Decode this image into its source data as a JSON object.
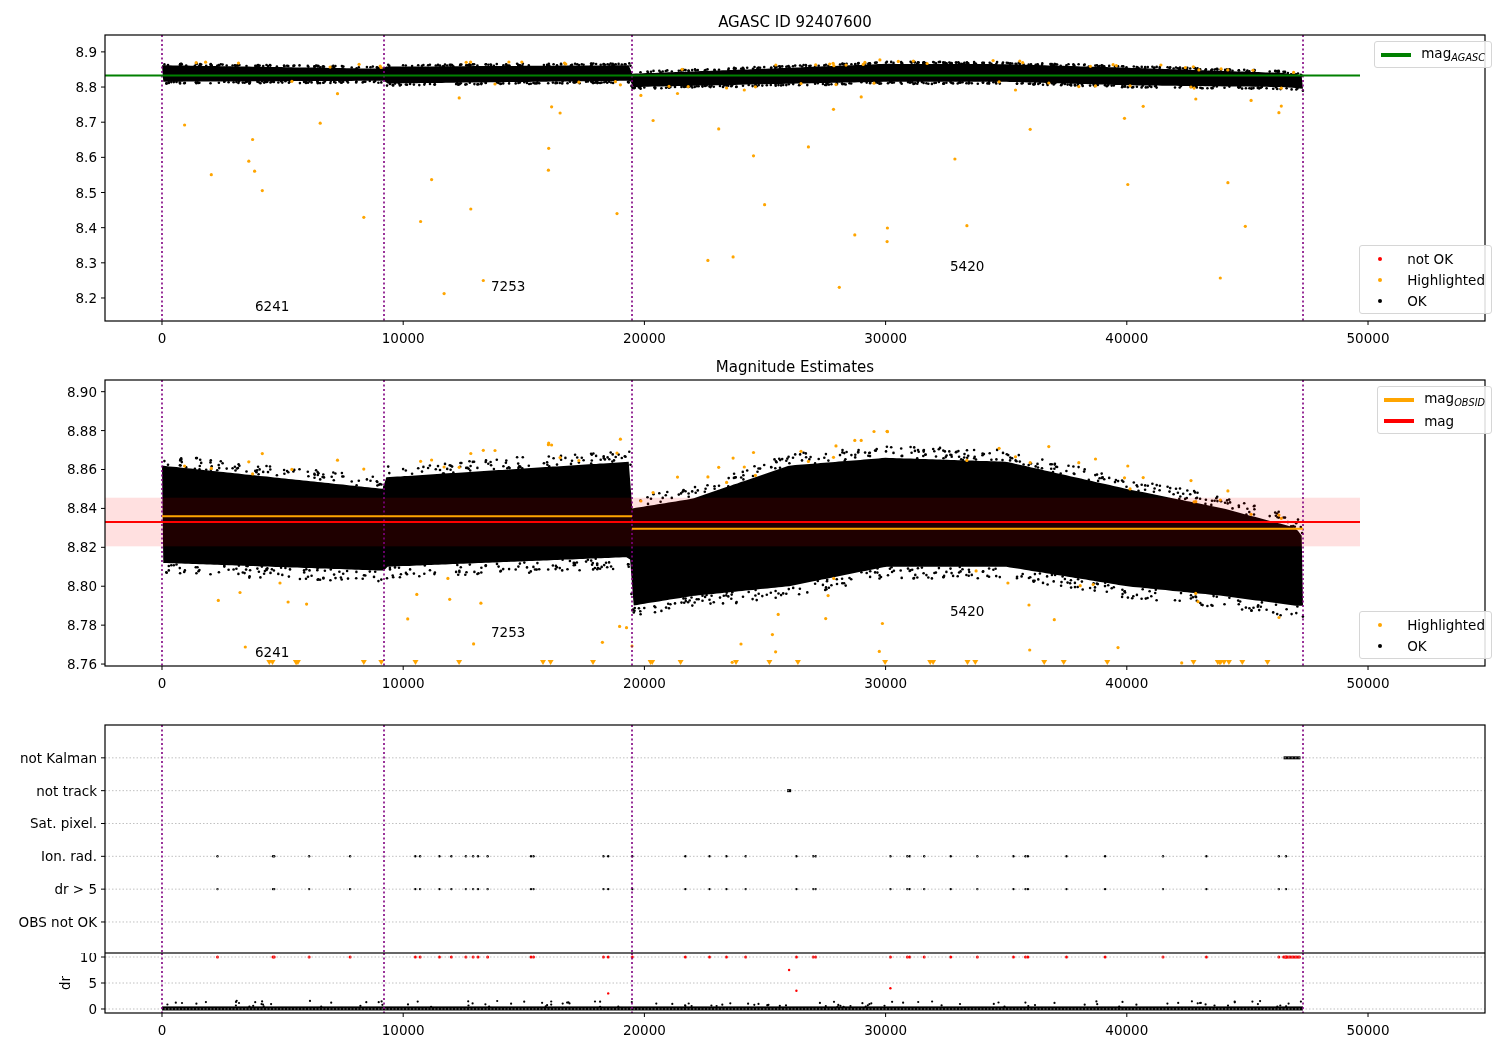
{
  "figure": {
    "panels": [
      {
        "kind": "agasc",
        "chart_data": {
          "type": "line",
          "title": "AGASC ID 92407600",
          "xlim": [
            -2363,
            54850
          ],
          "ylim": [
            8.1345,
            8.948
          ],
          "xticks": [
            0,
            10000,
            20000,
            30000,
            40000,
            50000
          ],
          "yticks": [
            8.2,
            8.3,
            8.4,
            8.5,
            8.6,
            8.7,
            8.8,
            8.9
          ],
          "series": [
            {
              "name": "mag$_{AGASC}$",
              "color": "#008000",
              "x": [
                -2363,
                49668
              ],
              "values": [
                8.833,
                8.833
              ]
            }
          ],
          "ref_lines": [
            {
              "axis": "x",
              "value": 0,
              "color": "#800080"
            },
            {
              "axis": "x",
              "value": 9204,
              "color": "#800080"
            },
            {
              "axis": "x",
              "value": 19486,
              "color": "#800080"
            },
            {
              "axis": "x",
              "value": 47305,
              "color": "#800080"
            }
          ],
          "annotations": [
            "6241",
            "7253",
            "5420"
          ]
        },
        "marker_legend": [
          {
            "label": "not OK",
            "color": "#ff0000"
          },
          {
            "label": "Highlighted",
            "color": "#ffa500"
          },
          {
            "label": "OK",
            "color": "#000000"
          }
        ]
      },
      {
        "kind": "obsid",
        "chart_data": {
          "type": "line",
          "title": "Magnitude Estimates",
          "xlim": [
            -2363,
            54850
          ],
          "ylim": [
            8.759,
            8.906
          ],
          "xticks": [
            0,
            10000,
            20000,
            30000,
            40000,
            50000
          ],
          "yticks": [
            {
              "value": 8.76,
              "label": "8.76"
            },
            {
              "value": 8.78,
              "label": "8.78"
            },
            {
              "value": 8.8,
              "label": "8.80"
            },
            {
              "value": 8.82,
              "label": "8.82"
            },
            {
              "value": 8.84,
              "label": "8.84"
            },
            {
              "value": 8.86,
              "label": "8.86"
            },
            {
              "value": 8.88,
              "label": "8.88"
            },
            {
              "value": 8.9,
              "label": "8.90"
            }
          ],
          "series": [
            {
              "name": "mag$_{OBSID}$",
              "color": "#ffa500",
              "x": [
                0,
                19486,
                19486,
                47305
              ],
              "values": [
                8.836,
                8.836,
                8.8295,
                8.8295
              ]
            },
            {
              "name": "mag",
              "color": "#ff0000",
              "x": [
                -2363,
                49668
              ],
              "values": [
                8.833,
                8.833
              ]
            }
          ],
          "bands": [
            {
              "axis": "y",
              "from": 8.8205,
              "to": 8.8455,
              "color": "#ff0000"
            }
          ],
          "ref_lines": [
            {
              "axis": "x",
              "value": 0,
              "color": "#800080"
            },
            {
              "axis": "x",
              "value": 9204,
              "color": "#800080"
            },
            {
              "axis": "x",
              "value": 19486,
              "color": "#800080"
            },
            {
              "axis": "x",
              "value": 47305,
              "color": "#800080"
            }
          ],
          "annotations": [
            "6241",
            "7253",
            "5420"
          ]
        },
        "marker_legend": [
          {
            "label": "Highlighted",
            "color": "#ffa500"
          },
          {
            "label": "OK",
            "color": "#000000"
          }
        ]
      },
      {
        "kind": "flags",
        "chart_data": {
          "type": "scatter",
          "orientation": "horizontal",
          "grid": true,
          "xlim": [
            -2363,
            54850
          ],
          "categories": [
            "not Kalman",
            "not track",
            "Sat. pixel.",
            "Ion. rad.",
            "dr > 5",
            "OBS not OK"
          ],
          "ref_lines": [
            {
              "axis": "x",
              "value": 0,
              "color": "#800080"
            },
            {
              "axis": "x",
              "value": 9204,
              "color": "#800080"
            },
            {
              "axis": "x",
              "value": 19486,
              "color": "#800080"
            },
            {
              "axis": "x",
              "value": 47305,
              "color": "#800080"
            }
          ]
        }
      },
      {
        "kind": "dr",
        "chart_data": {
          "type": "scatter",
          "grid": true,
          "ylabel": "dr",
          "xlim": [
            -2363,
            54850
          ],
          "ylim": [
            -0.77,
            10.77
          ],
          "xticks": [
            0,
            10000,
            20000,
            30000,
            40000,
            50000
          ],
          "yticks": [
            0,
            5,
            10
          ],
          "ref_lines": [
            {
              "axis": "x",
              "value": 0,
              "color": "#800080"
            },
            {
              "axis": "x",
              "value": 9204,
              "color": "#800080"
            },
            {
              "axis": "x",
              "value": 19486,
              "color": "#800080"
            },
            {
              "axis": "x",
              "value": 47305,
              "color": "#800080"
            }
          ]
        }
      }
    ]
  }
}
